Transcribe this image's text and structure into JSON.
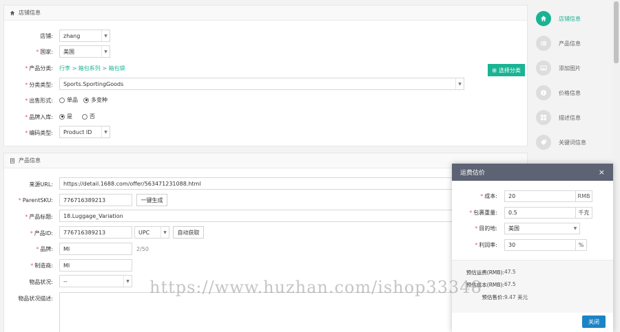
{
  "store_panel": {
    "title": "店铺信息",
    "store_label": "店铺:",
    "store_value": "zhang",
    "country_label": "国家:",
    "country_value": "美国",
    "category_label": "产品分类:",
    "category_path": "行李 > 箱包系列 > 箱包袋",
    "select_category_button": "选择分类",
    "category_type_label": "分类类型:",
    "category_type_value": "Sports.SportingGoods",
    "sell_form_label": "出售形式:",
    "sell_form_options": [
      "单品",
      "多变种"
    ],
    "sell_form_selected": "多变种",
    "brand_label": "品牌入库:",
    "brand_options": [
      "是",
      "否"
    ],
    "brand_selected": "是",
    "code_type_label": "编码类型:",
    "code_type_value": "Product ID"
  },
  "product_panel": {
    "title": "产品信息",
    "source_url_label": "来源URL:",
    "source_url_value": "https://detail.1688.com/offer/563471231088.html",
    "parent_sku_label": "ParentSKU:",
    "parent_sku_value": "776716389213",
    "generate_button": "一键生成",
    "product_title_label": "产品标题:",
    "product_title_value": "18.Luggage_Variation",
    "product_id_label": "产品ID:",
    "product_id_value": "776716389213",
    "product_id_type": "UPC",
    "auto_get_button": "自动获取",
    "brand_label": "品牌:",
    "brand_value": "MI",
    "brand_count": "2/50",
    "manufacturer_label": "制造商:",
    "manufacturer_value": "MI",
    "condition_label": "物品状况:",
    "condition_value": "--",
    "condition_desc_label": "物品状况描述:"
  },
  "steps": [
    {
      "label": "店铺信息",
      "icon": "home-icon",
      "active": true
    },
    {
      "label": "产品信息",
      "icon": "list-icon",
      "active": false
    },
    {
      "label": "添加图片",
      "icon": "image-icon",
      "active": false
    },
    {
      "label": "价格信息",
      "icon": "info-icon",
      "active": false
    },
    {
      "label": "描述信息",
      "icon": "grid-icon",
      "active": false
    },
    {
      "label": "关键词信息",
      "icon": "tag-icon",
      "active": false
    }
  ],
  "modal": {
    "title": "运费估价",
    "close": "×",
    "cost_label": "成本:",
    "cost_value": "20",
    "cost_unit": "RMB",
    "weight_label": "包裹重量:",
    "weight_value": "0.5",
    "weight_unit": "千克",
    "destination_label": "目的地:",
    "destination_value": "美国",
    "profit_label": "利润率:",
    "profit_value": "30",
    "profit_unit": "%",
    "est_shipping_label": "预估运费(RMB):",
    "est_shipping_value": "47.5",
    "est_cost_label": "预估成本(RMB):",
    "est_cost_value": "67.5",
    "est_price_label": "预估售价:",
    "est_price_value": "9.47 美元",
    "close_button": "关闭"
  },
  "watermark": "https://www.huzhan.com/ishop33348",
  "colors": {
    "accent": "#1ab394",
    "modal_header": "#5d6373",
    "button_blue": "#1c84c6",
    "required": "#ed5565"
  }
}
